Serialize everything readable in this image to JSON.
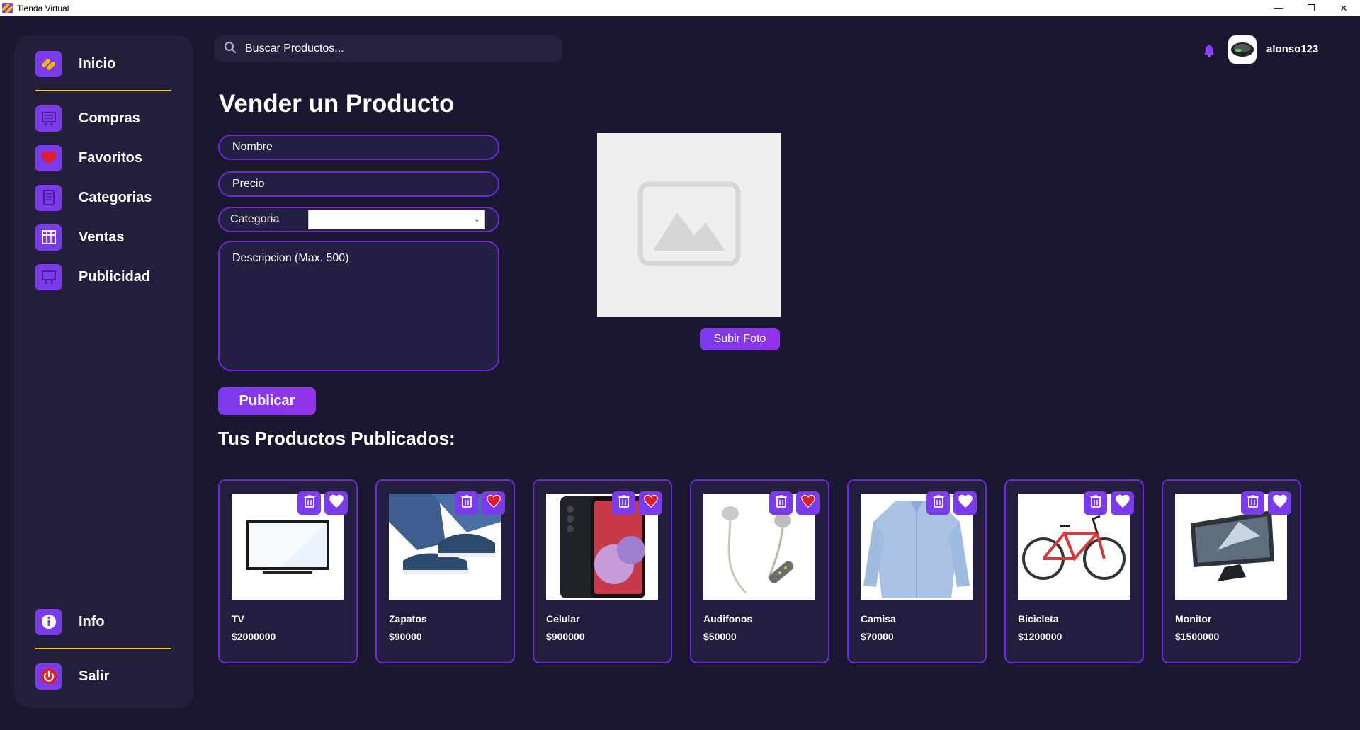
{
  "window": {
    "title": "Tienda Virtual",
    "controls": [
      "—",
      "❐",
      "✕"
    ]
  },
  "sidebar": {
    "items": [
      {
        "label": "Inicio",
        "icon": "home-logo-icon"
      },
      {
        "label": "Compras",
        "icon": "cart-icon"
      },
      {
        "label": "Favoritos",
        "icon": "heart-icon"
      },
      {
        "label": "Categorias",
        "icon": "list-icon"
      },
      {
        "label": "Ventas",
        "icon": "store-icon"
      },
      {
        "label": "Publicidad",
        "icon": "billboard-icon"
      }
    ],
    "bottom": [
      {
        "label": "Info",
        "icon": "info-icon"
      },
      {
        "label": "Salir",
        "icon": "power-icon"
      }
    ]
  },
  "search": {
    "placeholder": "Buscar Productos..."
  },
  "user": {
    "name": "alonso123"
  },
  "form": {
    "title": "Vender un Producto",
    "name_placeholder": "Nombre",
    "price_placeholder": "Precio",
    "category_label": "Categoria",
    "category_value": "",
    "description_placeholder": "Descripcion (Max. 500)",
    "upload_label": "Subir Foto",
    "publish_label": "Publicar"
  },
  "products": {
    "title": "Tus Productos Publicados:",
    "items": [
      {
        "name": "TV",
        "price": "$2000000",
        "favorite": false,
        "image": "tv"
      },
      {
        "name": "Zapatos",
        "price": "$90000",
        "favorite": true,
        "image": "shoes"
      },
      {
        "name": "Celular",
        "price": "$900000",
        "favorite": true,
        "image": "phone"
      },
      {
        "name": "Audifonos",
        "price": "$50000",
        "favorite": true,
        "image": "earphones"
      },
      {
        "name": "Camisa",
        "price": "$70000",
        "favorite": false,
        "image": "shirt"
      },
      {
        "name": "Bicicleta",
        "price": "$1200000",
        "favorite": false,
        "image": "bicycle"
      },
      {
        "name": "Monitor",
        "price": "$1500000",
        "favorite": false,
        "image": "monitor"
      }
    ]
  },
  "colors": {
    "background": "#1a1730",
    "panel": "#221e3b",
    "accent": "#7c3aed",
    "separator": "#f5c518",
    "heart_red": "#e11d2a"
  }
}
